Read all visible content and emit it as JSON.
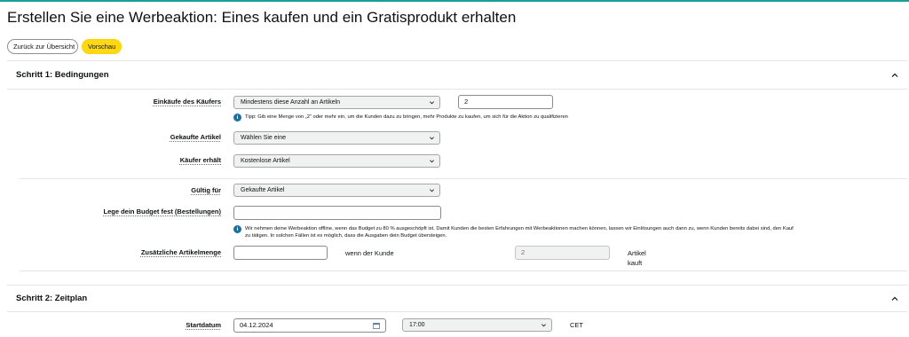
{
  "page": {
    "title": "Erstellen Sie eine Werbeaktion: Eines kaufen und ein Gratisprodukt erhalten"
  },
  "actions": {
    "back_label": "Zurück zur Übersicht",
    "preview_label": "Vorschau"
  },
  "step1": {
    "title": "Schritt 1: Bedingungen",
    "purchase": {
      "label": "Einkäufe des Käufers",
      "select_value": "Mindestens diese Anzahl an Artikeln",
      "quantity_value": "2",
      "tip": "Tipp: Gib eine Menge von „2“ oder mehr ein, um die Kunden dazu zu bringen, mehr Produkte zu kaufen, um sich für die Aktion zu qualifizieren"
    },
    "purchased_items": {
      "label": "Gekaufte Artikel",
      "select_value": "Wählen Sie eine"
    },
    "buyer_gets": {
      "label": "Käufer erhält",
      "select_value": "Kostenlose Artikel"
    },
    "valid_for": {
      "label": "Gültig für",
      "select_value": "Gekaufte Artikel"
    },
    "budget": {
      "label": "Lege dein Budget fest (Bestellungen)",
      "value": "",
      "info_line1": "Wir nehmen deine Werbeaktion offline, wenn das Budget zu 80 % ausgeschöpft ist. Damit Kunden die besten Erfahrungen mit Werbeaktionen machen können, lassen wir Einlösungen auch dann zu, wenn Kunden bereits dabei sind, den Kauf",
      "info_line2": "zu tätigen. In solchen Fällen ist es möglich, dass die Ausgaben dein Budget übersteigen."
    },
    "additional_quantity": {
      "label": "Zusätzliche Artikelmenge",
      "value": "",
      "when_text": "wenn der Kunde",
      "buys_value": "2",
      "suffix_line1": "Artikel",
      "suffix_line2": "kauft"
    }
  },
  "step2": {
    "title": "Schritt 2: Zeitplan",
    "start": {
      "label": "Startdatum",
      "date_value": "04.12.2024",
      "time_value": "17:00",
      "timezone": "CET"
    }
  },
  "icons": {
    "info": "info-icon",
    "collapse": "chevron-up-icon",
    "dropdown": "chevron-down-icon",
    "calendar": "calendar-icon"
  },
  "colors": {
    "accent_line": "#1c9c9a",
    "preview_button": "#ffd814",
    "info_icon": "#1d6fa0"
  }
}
